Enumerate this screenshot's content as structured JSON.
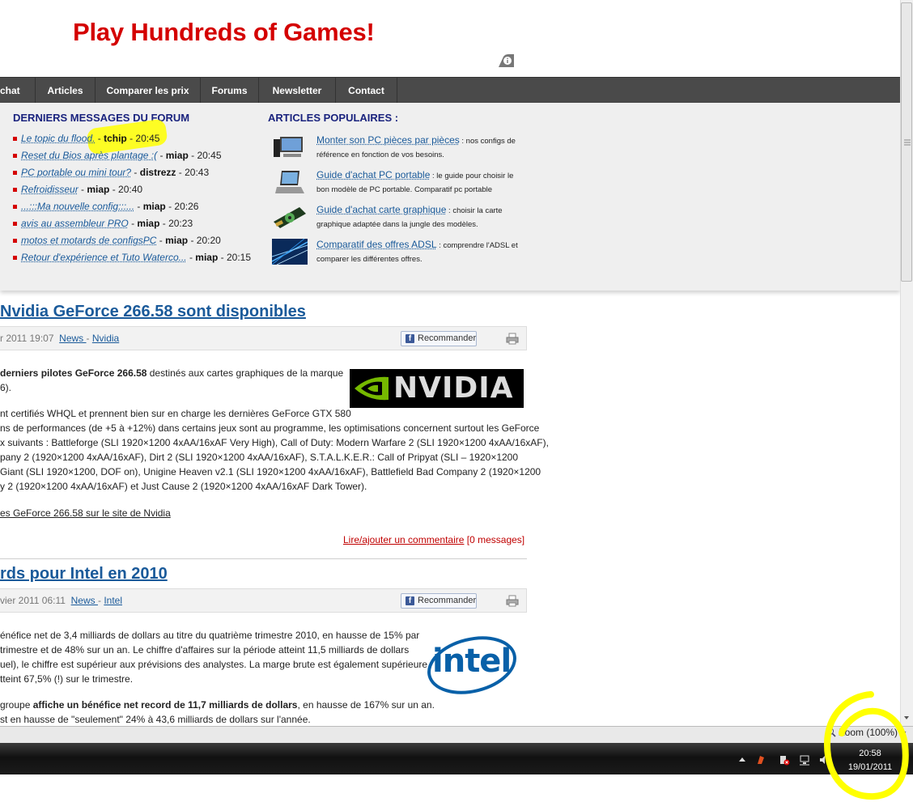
{
  "banner": {
    "title": "Play Hundreds of Games!"
  },
  "nav": {
    "items": [
      "chat",
      "Articles",
      "Comparer les prix",
      "Forums",
      "Newsletter",
      "Contact"
    ]
  },
  "forum": {
    "heading": "DERNIERS MESSAGES DU FORUM",
    "items": [
      {
        "title": "Le topic du flood.",
        "sep": " - ",
        "author": "tchip",
        "time": " - 20:45"
      },
      {
        "title": "Reset du Bios après plantage :(",
        "sep": " - ",
        "author": "miap",
        "time": " - 20:45"
      },
      {
        "title": "PC portable ou mini tour?",
        "sep": " - ",
        "author": "distrezz",
        "time": " - 20:43"
      },
      {
        "title": "Refroidisseur",
        "sep": " - ",
        "author": "miap",
        "time": " - 20:40"
      },
      {
        "title": "...:::Ma nouvelle config:::...",
        "sep": " - ",
        "author": "miap",
        "time": " - 20:26"
      },
      {
        "title": "avis au assembleur PRO",
        "sep": " - ",
        "author": "miap",
        "time": " - 20:23"
      },
      {
        "title": "motos et motards de configsPC",
        "sep": " - ",
        "author": "miap",
        "time": " - 20:20"
      },
      {
        "title": "Retour d'expérience et Tuto Waterco...",
        "sep": " - ",
        "author": "miap",
        "time": " - 20:15"
      }
    ]
  },
  "popular": {
    "heading": "ARTICLES POPULAIRES :",
    "items": [
      {
        "link": "Monter son PC pièces par pièces",
        "text": " : nos configs de référence en fonction de vos besoins."
      },
      {
        "link": "Guide d'achat PC portable",
        "text": " : le guide pour choisir le bon modèle de PC portable. Comparatif pc portable"
      },
      {
        "link": "Guide d'achat carte graphique",
        "text": " : choisir la carte graphique adaptée dans la jungle des modèles."
      },
      {
        "link": "Comparatif des offres ADSL",
        "text": " : comprendre l'ADSL et comparer les différentes offres."
      }
    ]
  },
  "article1": {
    "title": "Nvidia GeForce 266.58 sont disponibles",
    "date": "r 2011 19:07",
    "cat1": "News ",
    "cat_sep": "- ",
    "cat2": "Nvidia",
    "fb": "Recommander",
    "logo_text": "NVIDIA",
    "intro_bold": "derniers pilotes GeForce 266.58",
    "intro_rest": " destinés aux cartes graphiques de la marque",
    "line2": "6).",
    "para": [
      "nt certifiés WHQL et prennent bien sur en charge les dernières GeForce GTX 580",
      "ns de performances (de +5 à +12%) dans certains jeux sont au programme, les optimisations concernent surtout les GeForce",
      "x suivants : Battleforge (SLI 1920×1200 4xAA/16xAF Very High), Call of Duty: Modern Warfare 2 (SLI 1920×1200 4xAA/16xAF),",
      "pany 2 (1920×1200 4xAA/16xAF), Dirt 2 (SLI 1920×1200 4xAA/16xAF), S.T.A.L.K.E.R.: Call of Pripyat (SLI – 1920×1200",
      "Giant (SLI 1920×1200, DOF on), Unigine Heaven v2.1 (SLI 1920×1200 4xAA/16xAF), Battlefield Bad Company 2 (1920×1200",
      "y 2 (1920×1200 4xAA/16xAF) et Just Cause 2 (1920×1200 4xAA/16xAF Dark Tower)."
    ],
    "source_link": "es GeForce 266.58 sur le site de Nvidia",
    "comment_link": "Lire/ajouter un commentaire",
    "comment_count": " [0 messages]"
  },
  "article2": {
    "title": "rds pour Intel en 2010",
    "date": "vier 2011 06:11",
    "cat1": "News ",
    "cat_sep": "- ",
    "cat2": "Intel",
    "fb": "Recommander",
    "logo_text": "intel",
    "para": [
      "énéfice net de 3,4 milliards de dollars au titre du quatrième trimestre 2010, en hausse de 15% par",
      "trimestre et de 48% sur un an. Le chiffre d'affaires sur la période atteint 11,5 milliards de dollars",
      "uel), le chiffre est supérieur aux prévisions des analystes. La marge brute est également supérieure",
      "tteint 67,5% (!) sur le trimestre."
    ],
    "line5_pre": "groupe ",
    "line5_bold": "affiche un bénéfice net record de 11,7 milliards de dollars",
    "line5_post": ", en hausse de 167% sur un an.",
    "line6": "st en hausse de \"seulement\" 24% à 43,6 milliards de dollars sur l'année."
  },
  "statusbar": {
    "zoom": "Zoom (100%)"
  },
  "taskbar": {
    "time": "20:58",
    "date": "19/01/2011"
  },
  "colors": {
    "brand_red": "#d40000",
    "link_blue": "#1a5a9a",
    "heading_navy": "#1a237e",
    "highlighter": "#ffff00"
  }
}
